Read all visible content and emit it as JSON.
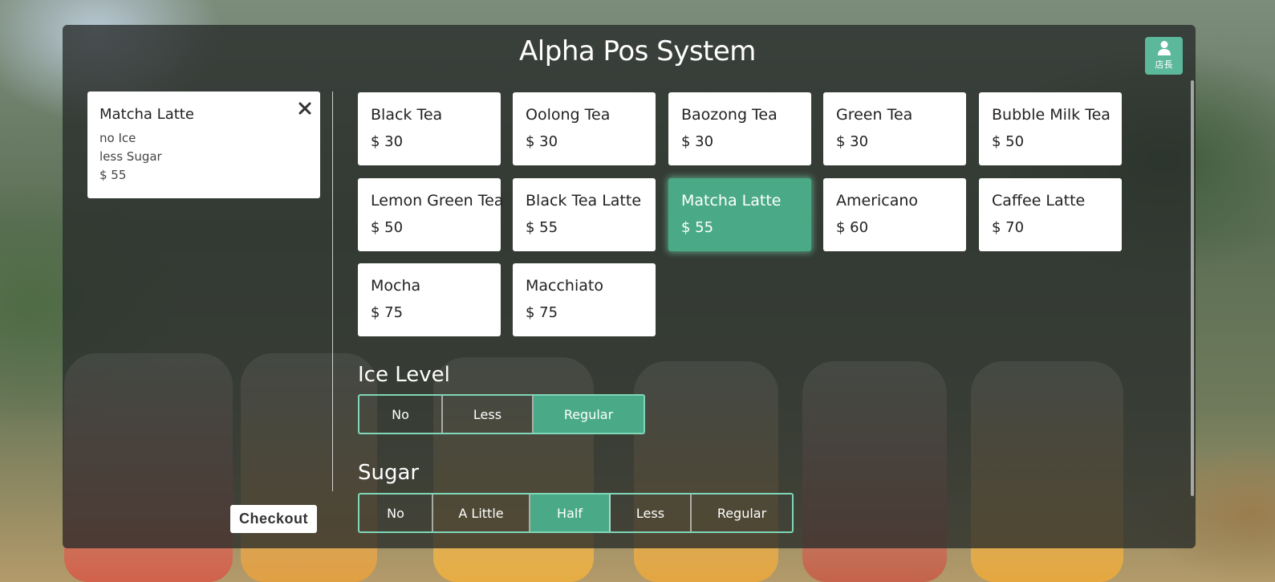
{
  "app": {
    "title": "Alpha Pos System",
    "manager_label": "店長"
  },
  "cart": {
    "items": [
      {
        "name": "Matcha Latte",
        "ice": "no Ice",
        "sugar": "less Sugar",
        "price": "$ 55"
      }
    ],
    "checkout_label": "Checkout"
  },
  "menu": {
    "items": [
      {
        "name": "Black Tea",
        "price": "$ 30",
        "selected": false
      },
      {
        "name": "Oolong Tea",
        "price": "$ 30",
        "selected": false
      },
      {
        "name": "Baozong Tea",
        "price": "$ 30",
        "selected": false
      },
      {
        "name": "Green Tea",
        "price": "$ 30",
        "selected": false
      },
      {
        "name": "Bubble Milk Tea",
        "price": "$ 50",
        "selected": false
      },
      {
        "name": "Lemon Green Tea",
        "price": "$ 50",
        "selected": false
      },
      {
        "name": "Black Tea Latte",
        "price": "$ 55",
        "selected": false
      },
      {
        "name": "Matcha Latte",
        "price": "$ 55",
        "selected": true
      },
      {
        "name": "Americano",
        "price": "$ 60",
        "selected": false
      },
      {
        "name": "Caffee Latte",
        "price": "$ 70",
        "selected": false
      },
      {
        "name": "Mocha",
        "price": "$ 75",
        "selected": false
      },
      {
        "name": "Macchiato",
        "price": "$ 75",
        "selected": false
      }
    ]
  },
  "ice_level": {
    "label": "Ice Level",
    "options": [
      "No",
      "Less",
      "Regular"
    ],
    "selected": "Regular"
  },
  "sugar": {
    "label": "Sugar",
    "options": [
      "No",
      "A Little",
      "Half",
      "Less",
      "Regular"
    ],
    "selected": "Half"
  },
  "colors": {
    "accent": "#4aaa87",
    "accent_border": "#7fd6b8",
    "panel": "#282c2a"
  }
}
